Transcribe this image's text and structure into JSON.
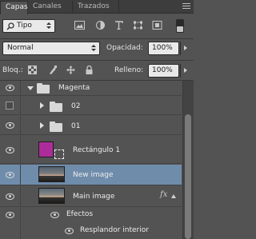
{
  "tabs": [
    {
      "label": "Capas",
      "active": true
    },
    {
      "label": "Canales",
      "active": false
    },
    {
      "label": "Trazados",
      "active": false
    }
  ],
  "filter": {
    "value": "Tipo"
  },
  "blend": {
    "value": "Normal"
  },
  "opacity": {
    "label": "Opacidad:",
    "value": "100%"
  },
  "lock": {
    "label": "Bloq.:"
  },
  "fill": {
    "label": "Relleno:",
    "value": "100%"
  },
  "layers": [
    {
      "name": "Magenta",
      "type": "group",
      "expanded": true,
      "visible": true
    },
    {
      "name": "02",
      "type": "group",
      "expanded": false,
      "visible": false
    },
    {
      "name": "01",
      "type": "group",
      "expanded": false,
      "visible": true
    },
    {
      "name": "Rectángulo 1",
      "type": "shape",
      "visible": true
    },
    {
      "name": "New image",
      "type": "image",
      "visible": true,
      "selected": true
    },
    {
      "name": "Main image",
      "type": "image",
      "visible": true,
      "fx": "fx"
    },
    {
      "name": "Efectos",
      "type": "effects-header",
      "visible": true
    },
    {
      "name": "Resplandor interior",
      "type": "effect",
      "visible": true
    }
  ],
  "colors": {
    "selected_row": "#6f8cab",
    "shape_fill": "#ad2c9a",
    "panel_bg": "#535353"
  }
}
